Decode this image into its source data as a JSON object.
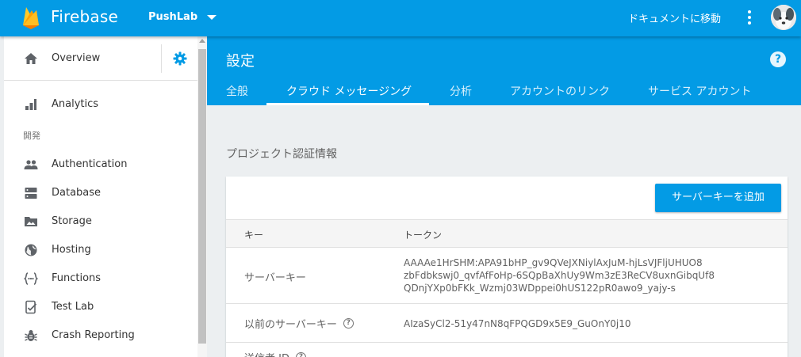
{
  "app": {
    "brand": "Firebase",
    "project": "PushLab",
    "docs_link": "ドキュメントに移動"
  },
  "sidebar": {
    "overview": "Overview",
    "section_develop": "開発",
    "items": [
      {
        "label": "Analytics",
        "icon": "analytics-icon"
      },
      {
        "label": "Authentication",
        "icon": "people-icon"
      },
      {
        "label": "Database",
        "icon": "database-icon"
      },
      {
        "label": "Storage",
        "icon": "photo-folder-icon"
      },
      {
        "label": "Hosting",
        "icon": "globe-icon"
      },
      {
        "label": "Functions",
        "icon": "functions-icon"
      },
      {
        "label": "Test Lab",
        "icon": "test-lab-icon"
      },
      {
        "label": "Crash Reporting",
        "icon": "bug-icon"
      }
    ]
  },
  "header": {
    "title": "設定",
    "tabs": [
      {
        "label": "全般"
      },
      {
        "label": "クラウド メッセージング"
      },
      {
        "label": "分析"
      },
      {
        "label": "アカウントのリンク"
      },
      {
        "label": "サービス アカウント"
      }
    ],
    "active_tab": "クラウド メッセージング"
  },
  "credentials": {
    "section_title": "プロジェクト認証情報",
    "add_button": "サーバーキーを追加",
    "columns": {
      "key": "キー",
      "token": "トークン"
    },
    "rows": [
      {
        "key": "サーバーキー",
        "token_lines": [
          "AAAAe1HrSHM:APA91bHP_gv9QVeJXNiylAxJuM-hjLsVJFljUHUO8",
          "zbFdbkswj0_qvfAfFoHp-6SQpBaXhUy9Wm3zE3ReCV8uxnGibqUf8",
          "QDnjYXp0bFKk_Wzmj03WDppei0hUS122pR0awo9_yajy-s"
        ]
      },
      {
        "key": "以前のサーバーキー",
        "token": "AIzaSyCl2-51y47nN8qFPQGD9x5E9_GuOnY0j10"
      },
      {
        "key": "送信者 ID"
      }
    ]
  },
  "colors": {
    "primary": "#039be5",
    "background": "#eceff1",
    "sidebar_bg": "#ffffff",
    "firebase_orange": "#ffa000",
    "firebase_yellow": "#ffca28"
  }
}
